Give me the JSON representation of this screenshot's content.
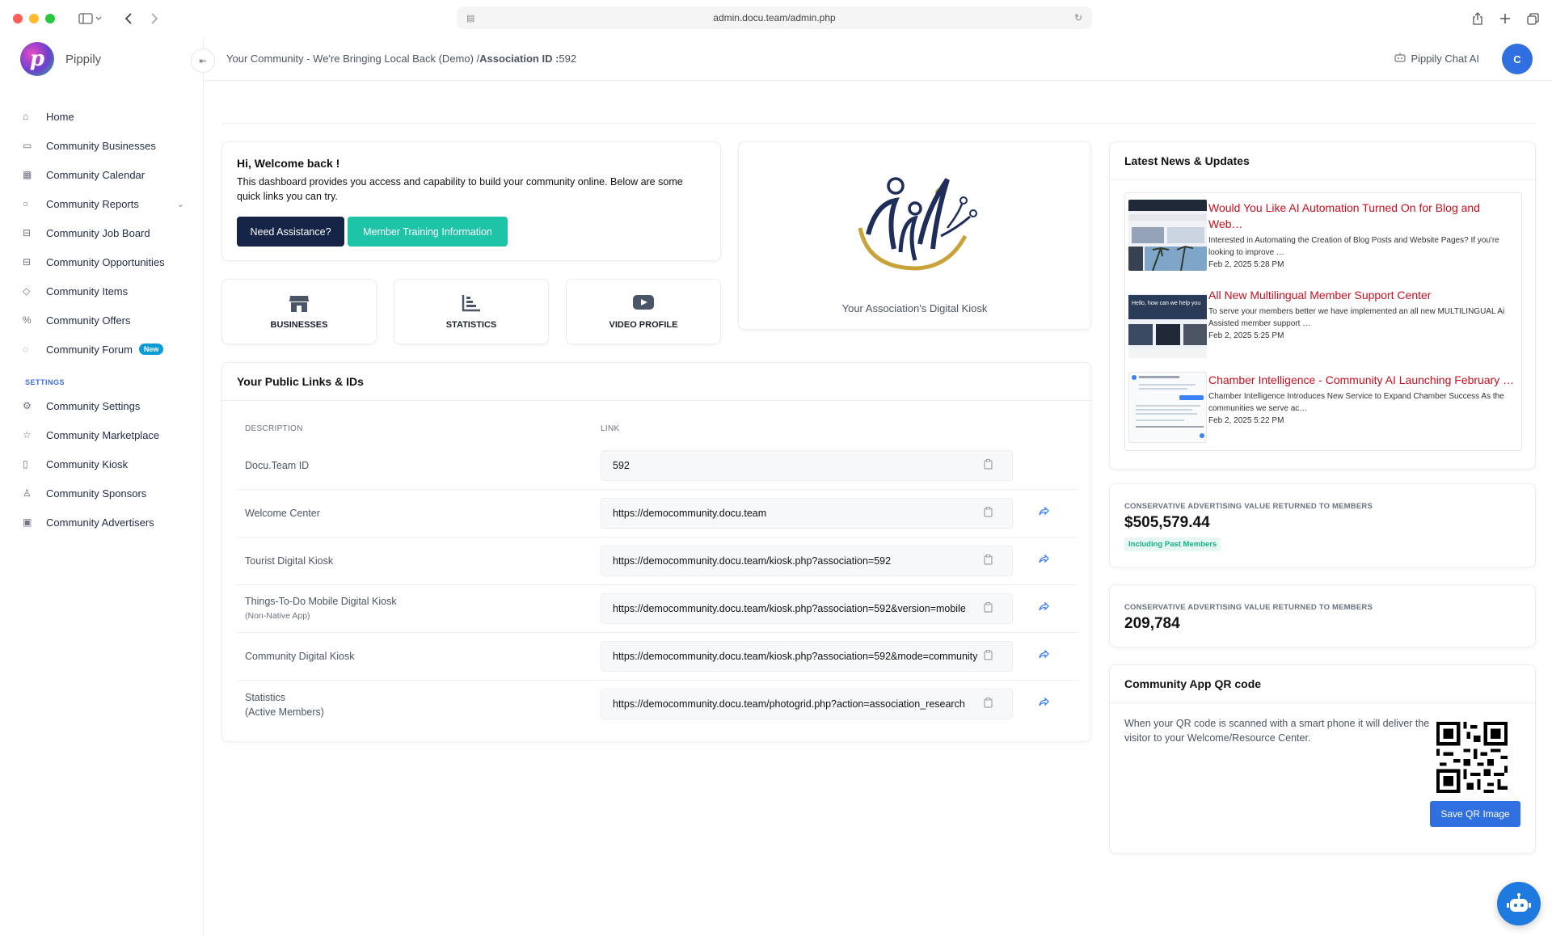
{
  "browser": {
    "url": "admin.docu.team/admin.php"
  },
  "brand": {
    "logo_letter": "p",
    "name": "Pippily"
  },
  "sidebar": {
    "items": [
      {
        "label": "Home",
        "icon": "home-icon"
      },
      {
        "label": "Community Businesses",
        "icon": "briefcase-icon"
      },
      {
        "label": "Community Calendar",
        "icon": "calendar-icon"
      },
      {
        "label": "Community Reports",
        "icon": "circle-icon",
        "has_submenu": true
      },
      {
        "label": "Community Job Board",
        "icon": "ticket-icon"
      },
      {
        "label": "Community Opportunities",
        "icon": "ticket-icon"
      },
      {
        "label": "Community Items",
        "icon": "tag-icon"
      },
      {
        "label": "Community Offers",
        "icon": "percent-icon"
      },
      {
        "label": "Community Forum",
        "icon": "chat-icon",
        "badge": "New"
      }
    ],
    "settings_label": "SETTINGS",
    "settings_items": [
      {
        "label": "Community Settings",
        "icon": "gear-icon"
      },
      {
        "label": "Community Marketplace",
        "icon": "star-icon"
      },
      {
        "label": "Community Kiosk",
        "icon": "tablet-icon"
      },
      {
        "label": "Community Sponsors",
        "icon": "user-icon"
      },
      {
        "label": "Community Advertisers",
        "icon": "ad-icon"
      }
    ]
  },
  "header": {
    "breadcrumb_prefix": "Your Community - We're Bringing Local Back (Demo) /",
    "breadcrumb_label": "Association ID :",
    "association_id": "592",
    "chat_ai": "Pippily Chat AI",
    "avatar_initial": "C"
  },
  "welcome": {
    "title": "Hi, Welcome back !",
    "text": "This dashboard provides you access and capability to build your community online. Below are some quick links you can try.",
    "btn_assist": "Need Assistance?",
    "btn_training": "Member Training Information"
  },
  "quick_links": [
    {
      "label": "BUSINESSES",
      "icon": "store-icon"
    },
    {
      "label": "STATISTICS",
      "icon": "bar-chart-icon"
    },
    {
      "label": "VIDEO PROFILE",
      "icon": "youtube-icon"
    }
  ],
  "kiosk": {
    "label": "Your Association's Digital Kiosk"
  },
  "links": {
    "title": "Your Public Links & IDs",
    "col_desc": "DESCRIPTION",
    "col_link": "LINK",
    "rows": [
      {
        "desc": "Docu.Team ID",
        "sub": "",
        "value": "592",
        "share": false
      },
      {
        "desc": "Welcome Center",
        "sub": "",
        "value": "https://democommunity.docu.team",
        "share": true
      },
      {
        "desc": "Tourist Digital Kiosk",
        "sub": "",
        "value": "https://democommunity.docu.team/kiosk.php?association=592",
        "share": true
      },
      {
        "desc": "Things-To-Do Mobile Digital Kiosk",
        "sub": "(Non-Native App)",
        "value": "https://democommunity.docu.team/kiosk.php?association=592&version=mobile",
        "share": true
      },
      {
        "desc": "Community Digital Kiosk",
        "sub": "",
        "value": "https://democommunity.docu.team/kiosk.php?association=592&mode=community",
        "share": true
      },
      {
        "desc": "Statistics",
        "sub": "(Active Members)",
        "value": "https://democommunity.docu.team/photogrid.php?action=association_research",
        "share": true
      }
    ]
  },
  "news": {
    "title": "Latest News & Updates",
    "items": [
      {
        "headline": "Would You Like AI Automation Turned On for Blog and Web…",
        "desc": "Interested in Automating the Creation of Blog Posts and Website Pages? If you're looking to improve …",
        "date": "Feb 2, 2025 5:28 PM"
      },
      {
        "headline": "All New Multilingual Member Support Center",
        "desc": "To serve your members better we have implemented an all new MULTILINGUAL Ai Assisted member support …",
        "date": "Feb 2, 2025 5:25 PM",
        "thumb_text": "Hello, how can we help you"
      },
      {
        "headline": "Chamber Intelligence - Community AI Launching February …",
        "desc": "Chamber Intelligence Introduces New Service to Expand Chamber Success As the communities we serve ac…",
        "date": "Feb 2, 2025 5:22 PM"
      }
    ]
  },
  "stats": [
    {
      "label": "CONSERVATIVE ADVERTISING VALUE RETURNED TO MEMBERS",
      "value": "$505,579.44",
      "tag": "Including Past Members"
    },
    {
      "label": "CONSERVATIVE ADVERTISING VALUE RETURNED TO MEMBERS",
      "value": "209,784",
      "tag": ""
    }
  ],
  "qr": {
    "title": "Community App QR code",
    "text": "When your QR code is scanned with a smart phone it will deliver the visitor to your Welcome/Resource Center.",
    "button": "Save QR Image"
  },
  "colors": {
    "primary_dark": "#162447",
    "teal": "#1dc4a8",
    "blue": "#2f6fe0",
    "news_red": "#c80f1e"
  }
}
